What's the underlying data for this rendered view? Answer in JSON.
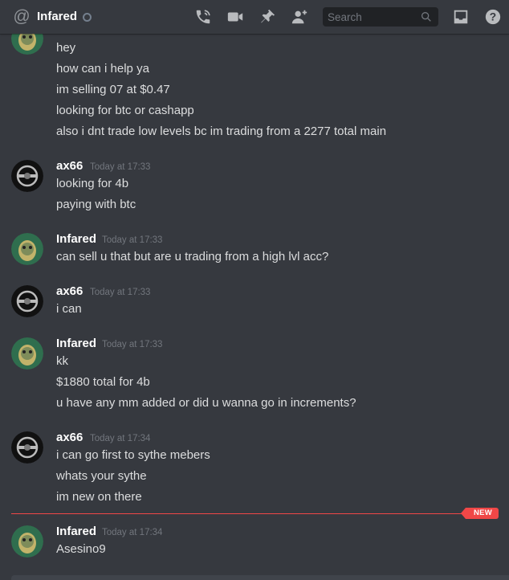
{
  "header": {
    "channel_name": "Infared",
    "search_placeholder": "Search",
    "icons": [
      "at-icon",
      "call-icon",
      "video-icon",
      "pin-icon",
      "add-friend-icon",
      "search-icon",
      "inbox-icon",
      "help-icon"
    ]
  },
  "colors": {
    "background": "#36393f",
    "header_text": "#ffffff",
    "message_text": "#dcddde",
    "timestamp": "#72767d",
    "new_divider": "#f04747"
  },
  "messages": [
    {
      "lines": [
        "hey",
        "how can i help ya",
        "im selling 07 at $0.47",
        "looking for btc or cashapp",
        "also i dnt trade low levels bc im trading from a 2277 total main"
      ]
    },
    {
      "user": "ax66",
      "time": "Today at 17:33",
      "lines": [
        "looking for 4b",
        "paying with btc"
      ]
    },
    {
      "user": "Infared",
      "time": "Today at 17:33",
      "lines": [
        "can sell u that but are u trading from a high lvl acc?"
      ]
    },
    {
      "user": "ax66",
      "time": "Today at 17:33",
      "lines": [
        "i can"
      ]
    },
    {
      "user": "Infared",
      "time": "Today at 17:33",
      "lines": [
        "kk",
        "$1880 total for 4b",
        "u have any mm added or did u wanna go in increments?"
      ]
    },
    {
      "user": "ax66",
      "time": "Today at 17:34",
      "lines": [
        "i can go first to sythe mebers",
        "whats your sythe",
        "im new on there"
      ]
    },
    {
      "user": "Infared",
      "time": "Today at 17:34",
      "lines": [
        "Asesino9"
      ]
    }
  ],
  "new_divider_label": "NEW"
}
